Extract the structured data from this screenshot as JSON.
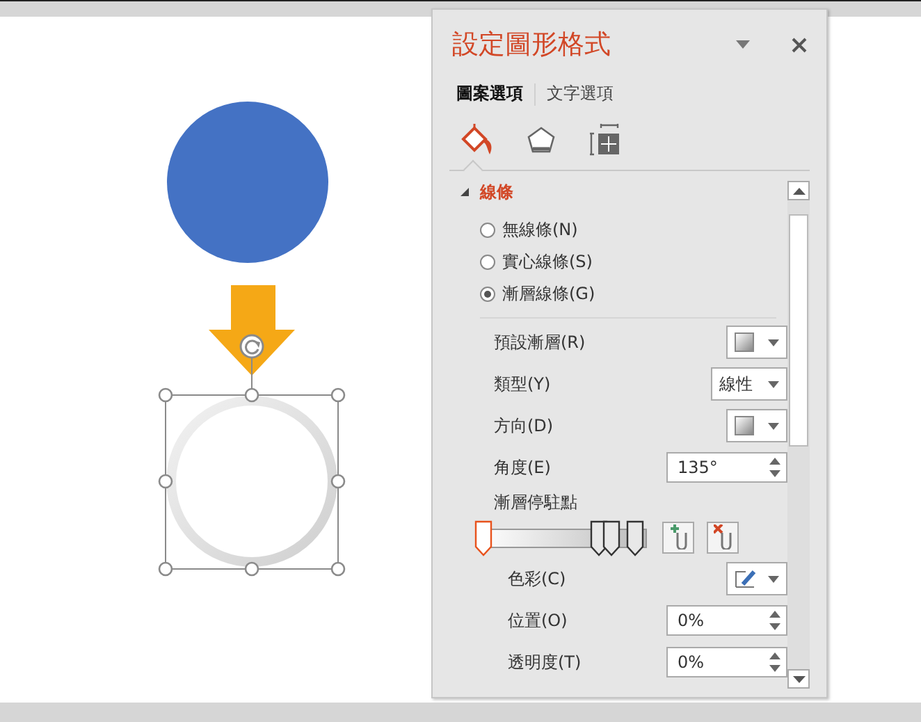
{
  "pane": {
    "title": "設定圖形格式",
    "tabs": [
      {
        "label": "圖案選項",
        "selected": true
      },
      {
        "label": "文字選項",
        "selected": false
      }
    ],
    "icon_tabs": [
      {
        "kind": "fill",
        "selected": true
      },
      {
        "kind": "effects",
        "selected": false
      },
      {
        "kind": "size",
        "selected": false
      }
    ],
    "section": {
      "label": "線條",
      "expanded": true,
      "radios": [
        {
          "label": "無線條(N)",
          "selected": false
        },
        {
          "label": "實心線條(S)",
          "selected": false
        },
        {
          "label": "漸層線條(G)",
          "selected": true
        }
      ],
      "rows": [
        {
          "kind": "swatch",
          "label": "預設漸層(R)"
        },
        {
          "kind": "text-dropdown",
          "label": "類型(Y)",
          "value": "線性"
        },
        {
          "kind": "swatch",
          "label": "方向(D)"
        },
        {
          "kind": "spinner",
          "label": "角度(E)",
          "value": "135°"
        },
        {
          "kind": "heading",
          "label": "漸層停駐點"
        },
        {
          "kind": "stops",
          "stops": [
            {
              "level": 0.0,
              "selected": true
            },
            {
              "level": 0.74,
              "selected": false
            },
            {
              "level": 0.82,
              "selected": false
            },
            {
              "level": 0.97,
              "selected": false
            }
          ]
        },
        {
          "kind": "color",
          "label": "色彩(C)"
        },
        {
          "kind": "spinner",
          "label": "位置(O)",
          "value": "0%"
        },
        {
          "kind": "spinner",
          "label": "透明度(T)",
          "value": "0%"
        }
      ]
    }
  }
}
